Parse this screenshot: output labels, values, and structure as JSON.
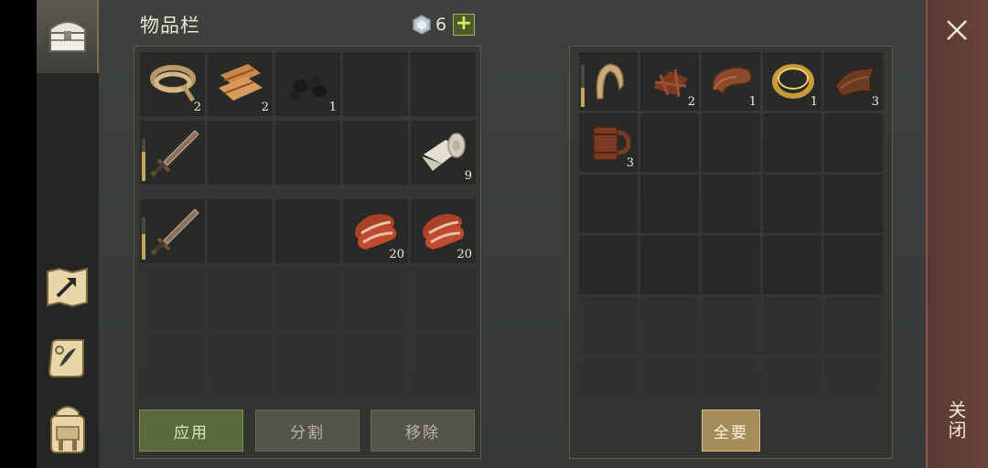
{
  "header": {
    "title": "物品栏",
    "gem_count": "6",
    "plus_label": "+"
  },
  "left_inventory": {
    "top_slots": [
      {
        "icon": "rope-icon",
        "count": "2"
      },
      {
        "icon": "cloth-scraps-icon",
        "count": "2"
      },
      {
        "icon": "coal-icon",
        "count": "1"
      },
      {
        "icon": "",
        "count": ""
      },
      {
        "icon": "",
        "count": ""
      },
      {
        "icon": "sword-icon",
        "count": "",
        "durability": 0.7
      },
      {
        "icon": "",
        "count": ""
      },
      {
        "icon": "",
        "count": ""
      },
      {
        "icon": "",
        "count": ""
      },
      {
        "icon": "linen-roll-icon",
        "count": "9"
      }
    ],
    "bottom_slots": [
      {
        "icon": "sword-icon",
        "count": "",
        "durability": 0.6
      },
      {
        "icon": "",
        "count": ""
      },
      {
        "icon": "",
        "count": ""
      },
      {
        "icon": "raw-meat-icon",
        "count": "20"
      },
      {
        "icon": "raw-meat-icon",
        "count": "20"
      }
    ]
  },
  "buttons": {
    "apply": "应用",
    "split": "分割",
    "remove": "移除",
    "take_all": "全要"
  },
  "right_container": {
    "slots": [
      {
        "icon": "leather-hood-icon",
        "count": "",
        "durability": 0.45
      },
      {
        "icon": "leather-scraps-icon",
        "count": "2"
      },
      {
        "icon": "leather-strap-icon",
        "count": "1"
      },
      {
        "icon": "gold-ring-icon",
        "count": "1"
      },
      {
        "icon": "leather-icon",
        "count": "3"
      },
      {
        "icon": "wooden-mug-icon",
        "count": "3"
      }
    ]
  },
  "close": {
    "label": "关闭"
  },
  "colors": {
    "background": "#3a3d3a",
    "slot": "#282a28",
    "durability": "#c6a45a",
    "apply_green": "#5a6a3a",
    "take_all_gold": "#a68c58",
    "close_panel": "#5a3832"
  }
}
